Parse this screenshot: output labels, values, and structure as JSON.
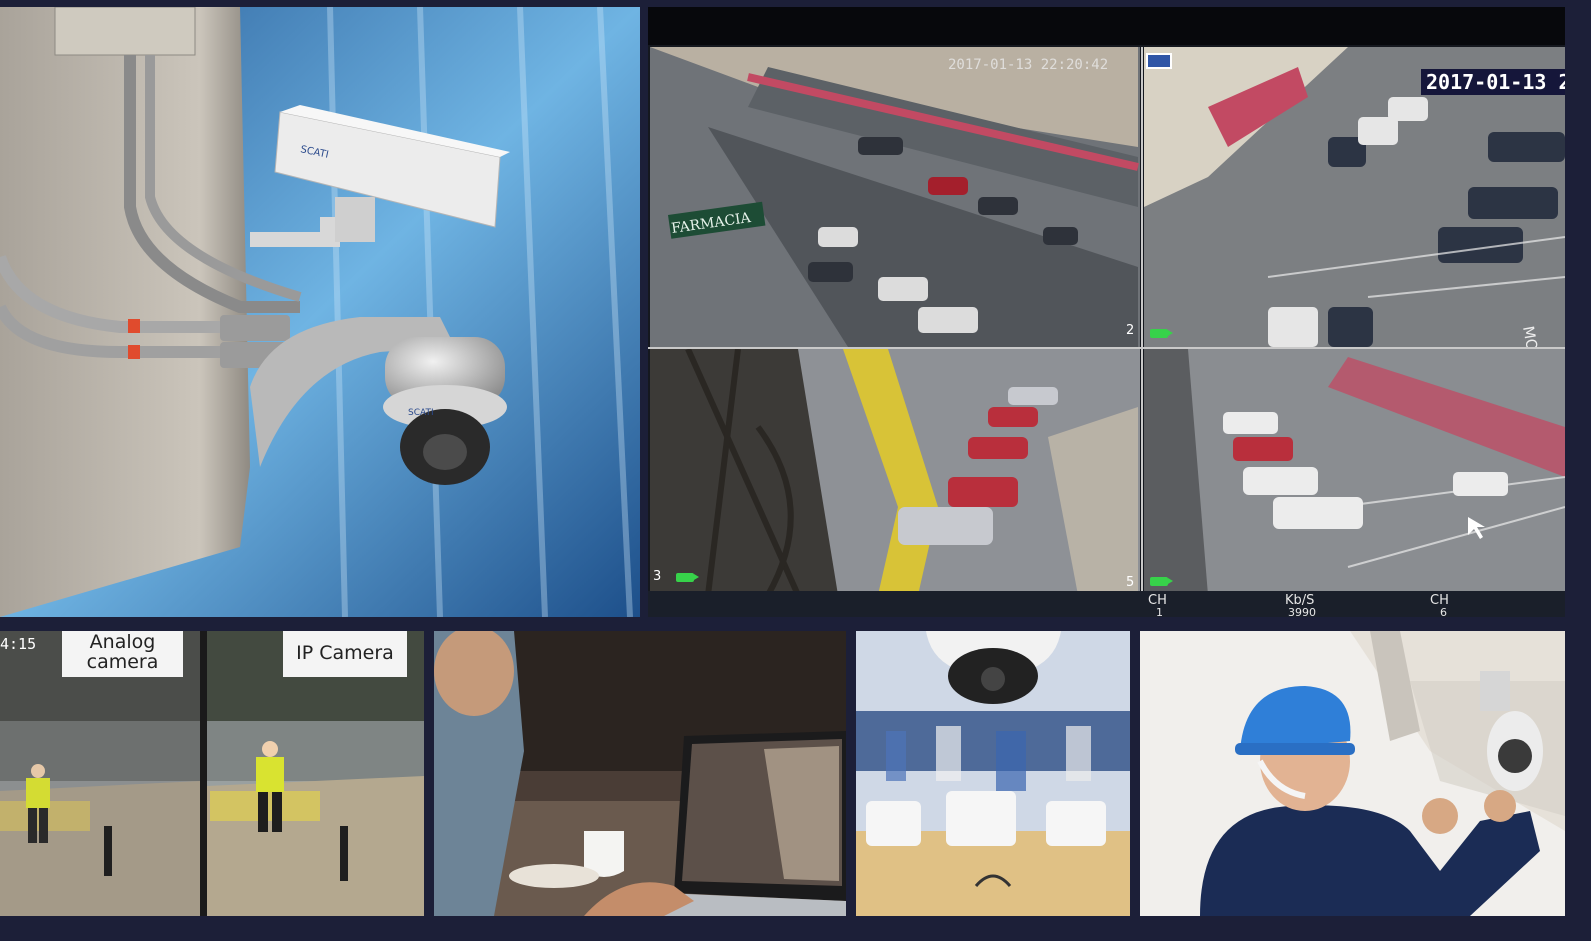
{
  "colors": {
    "frame": "#1c1f38",
    "sky": "#3f87c5",
    "concrete": "#bdb7ad",
    "nvr_bg": "#15181f"
  },
  "camera_brand": {
    "top": "SCATI",
    "dome": "SCATI"
  },
  "dvr": {
    "timestamp_main": "2017-01-13 2",
    "timestamp_ch1": "2017-01-13 22:20:42",
    "storefront_sign": "FARMACIA",
    "street_marking": "MOTO",
    "channels": [
      "2",
      "3",
      "5"
    ],
    "status_bar": {
      "col1": "CH",
      "col1_value": "1",
      "col2": "Kb/S",
      "col2_value": "3990",
      "col3": "CH",
      "col3_value": "6"
    }
  },
  "compare": {
    "clock": "4:15",
    "analog_label_line1": "Analog",
    "analog_label_line2": "camera",
    "ip_label": "IP Camera"
  },
  "icons": [
    "security-camera-icon",
    "dome-camera-icon",
    "laptop-icon",
    "hard-hat-icon"
  ]
}
